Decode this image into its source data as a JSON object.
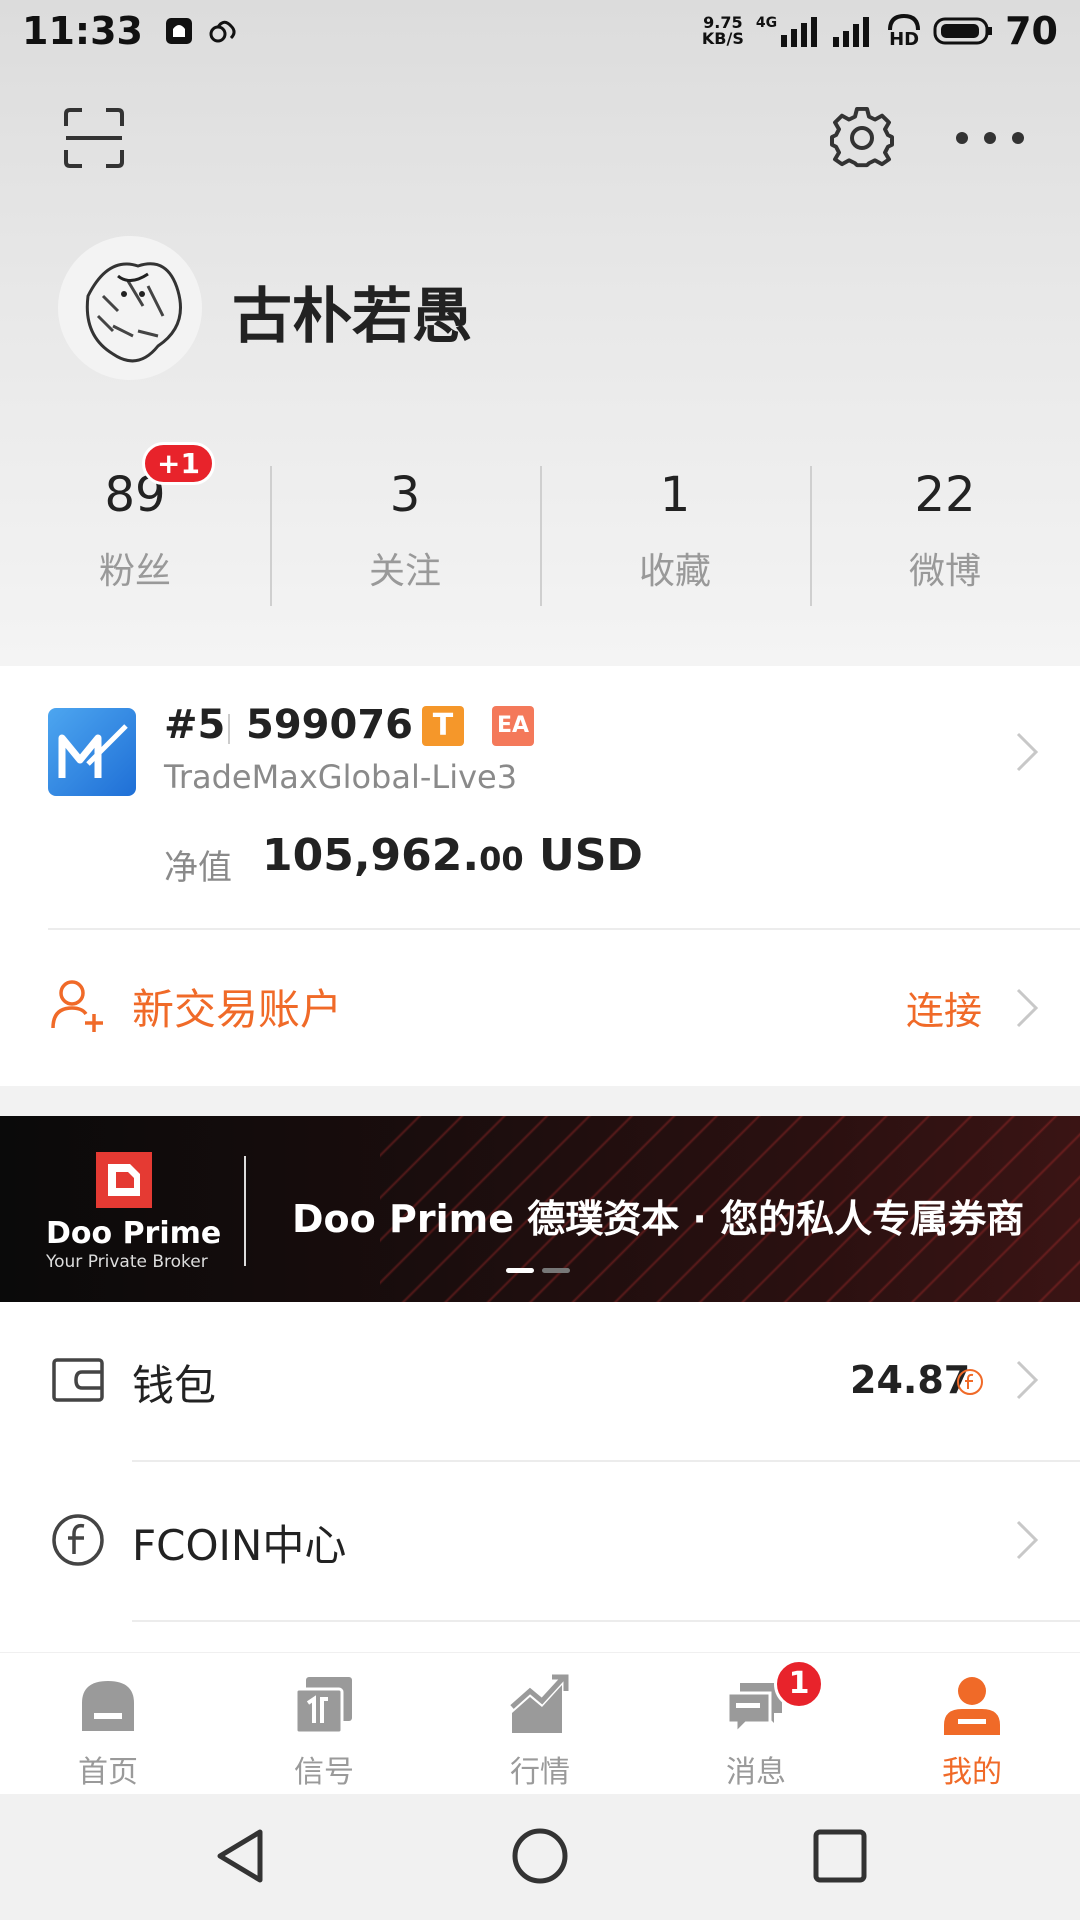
{
  "status_bar": {
    "time": "11:33",
    "net_speed_value": "9.75",
    "net_speed_unit": "KB/S",
    "network": "4G",
    "hd": "HD",
    "battery": "70"
  },
  "profile": {
    "username": "古朴若愚"
  },
  "stats": [
    {
      "value": "89",
      "label": "粉丝",
      "badge": "+1"
    },
    {
      "value": "3",
      "label": "关注"
    },
    {
      "value": "1",
      "label": "收藏"
    },
    {
      "value": "22",
      "label": "微博"
    }
  ],
  "account": {
    "rank": "#5",
    "id": "599076",
    "tag_t": "T",
    "tag_ea": "EA",
    "server": "TradeMaxGlobal-Live3",
    "equity_label": "净值",
    "equity_int": "105,962.",
    "equity_dec": "00",
    "equity_currency": "USD"
  },
  "new_account": {
    "label": "新交易账户",
    "action": "连接"
  },
  "banner": {
    "brand": "Doo Prime",
    "tagline": "Your Private Broker",
    "headline": "Doo Prime 德璞资本 · 您的私人专属券商"
  },
  "list": {
    "wallet_label": "钱包",
    "wallet_value": "24.87",
    "fcoin_label": "FCOIN中心"
  },
  "tabs": [
    {
      "label": "首页"
    },
    {
      "label": "信号"
    },
    {
      "label": "行情"
    },
    {
      "label": "消息",
      "badge": "1"
    },
    {
      "label": "我的"
    }
  ],
  "colors": {
    "accent": "#f06a28",
    "badge": "#e8232b"
  }
}
